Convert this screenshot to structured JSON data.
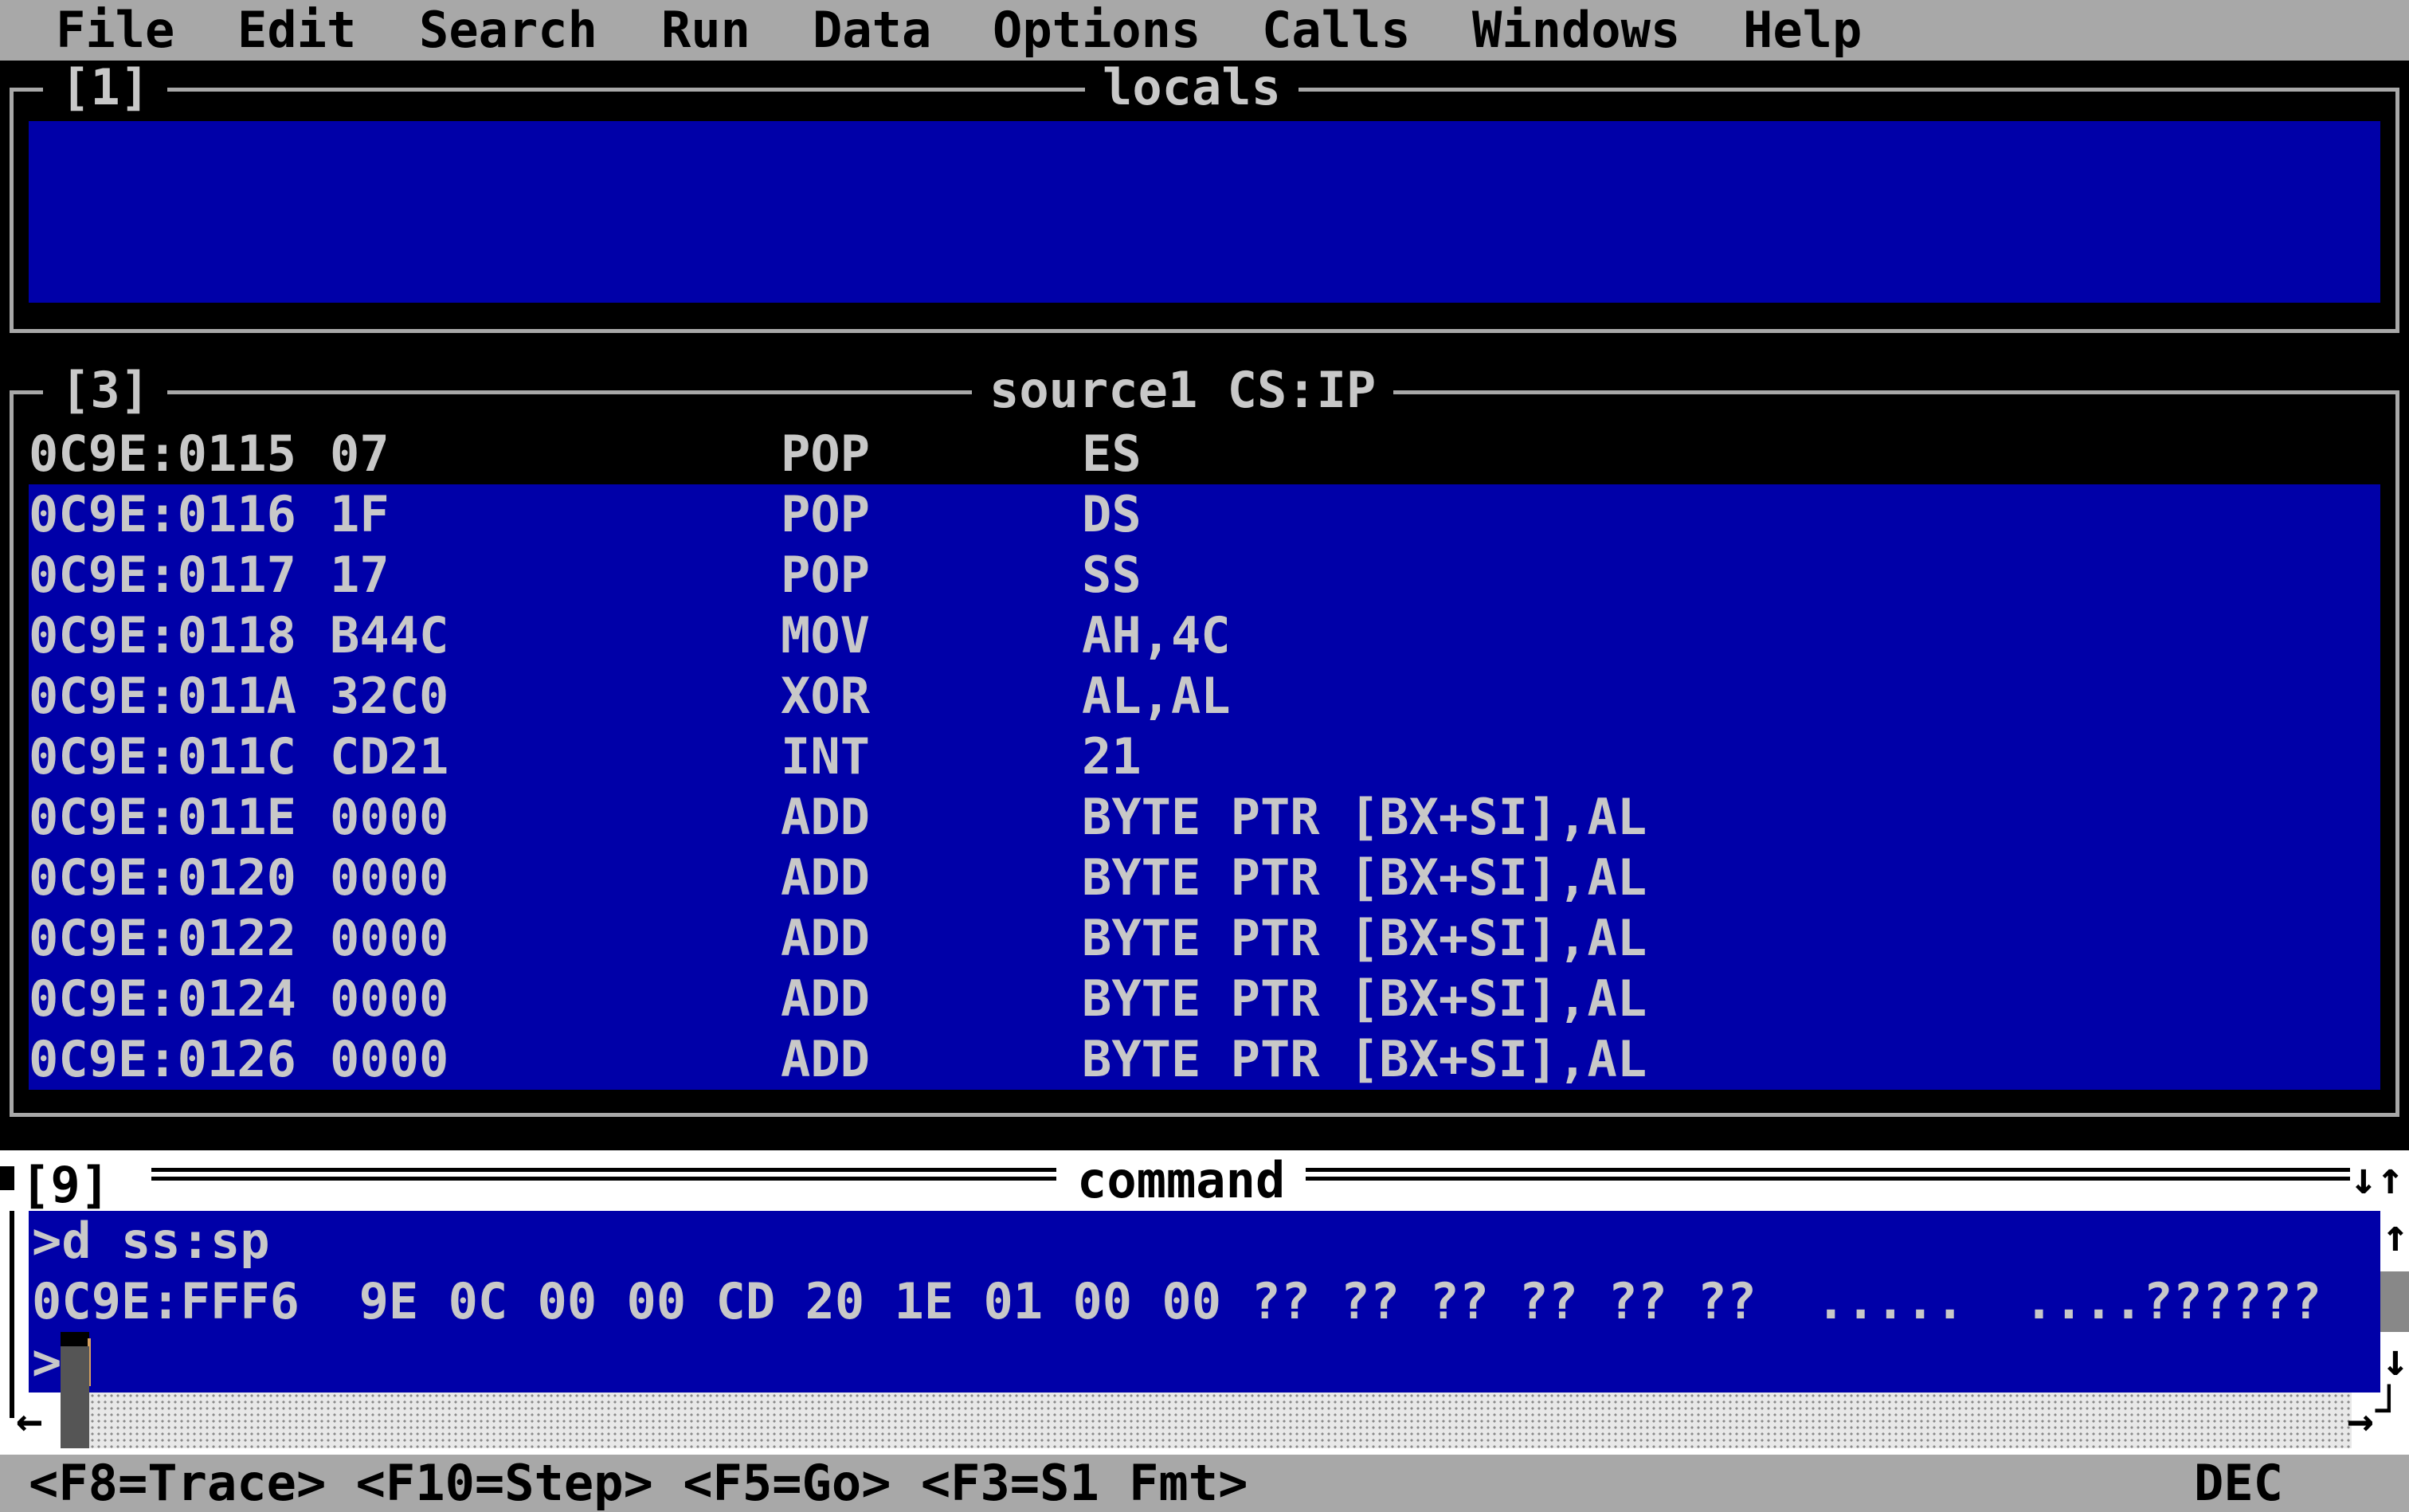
{
  "menu": [
    "File",
    "Edit",
    "Search",
    "Run",
    "Data",
    "Options",
    "Calls",
    "Windows",
    "Help"
  ],
  "locals_window": {
    "number": "[1]",
    "title": "locals"
  },
  "source_window": {
    "number": "[3]",
    "title": "source1 CS:IP",
    "rows": [
      {
        "addr": "0C9E:0115",
        "bytes": "07",
        "op": "POP",
        "args": "ES"
      },
      {
        "addr": "0C9E:0116",
        "bytes": "1F",
        "op": "POP",
        "args": "DS"
      },
      {
        "addr": "0C9E:0117",
        "bytes": "17",
        "op": "POP",
        "args": "SS"
      },
      {
        "addr": "0C9E:0118",
        "bytes": "B44C",
        "op": "MOV",
        "args": "AH,4C"
      },
      {
        "addr": "0C9E:011A",
        "bytes": "32C0",
        "op": "XOR",
        "args": "AL,AL"
      },
      {
        "addr": "0C9E:011C",
        "bytes": "CD21",
        "op": "INT",
        "args": "21"
      },
      {
        "addr": "0C9E:011E",
        "bytes": "0000",
        "op": "ADD",
        "args": "BYTE PTR [BX+SI],AL"
      },
      {
        "addr": "0C9E:0120",
        "bytes": "0000",
        "op": "ADD",
        "args": "BYTE PTR [BX+SI],AL"
      },
      {
        "addr": "0C9E:0122",
        "bytes": "0000",
        "op": "ADD",
        "args": "BYTE PTR [BX+SI],AL"
      },
      {
        "addr": "0C9E:0124",
        "bytes": "0000",
        "op": "ADD",
        "args": "BYTE PTR [BX+SI],AL"
      },
      {
        "addr": "0C9E:0126",
        "bytes": "0000",
        "op": "ADD",
        "args": "BYTE PTR [BX+SI],AL"
      }
    ]
  },
  "command_window": {
    "number": "[9]",
    "title": "command",
    "lines": [
      ">d ss:sp",
      "0C9E:FFF6  9E 0C 00 00 CD 20 1E 01 00 00 ?? ?? ?? ?? ?? ??  .....  ....??????",
      ">"
    ]
  },
  "status": {
    "keys": "<F8=Trace> <F10=Step> <F5=Go> <F3=S1 Fmt>",
    "mode": "DEC"
  },
  "colors": {
    "window_bg": "#0000a8",
    "bar_bg": "#a8a8a8",
    "text": "#c8c8c8"
  }
}
